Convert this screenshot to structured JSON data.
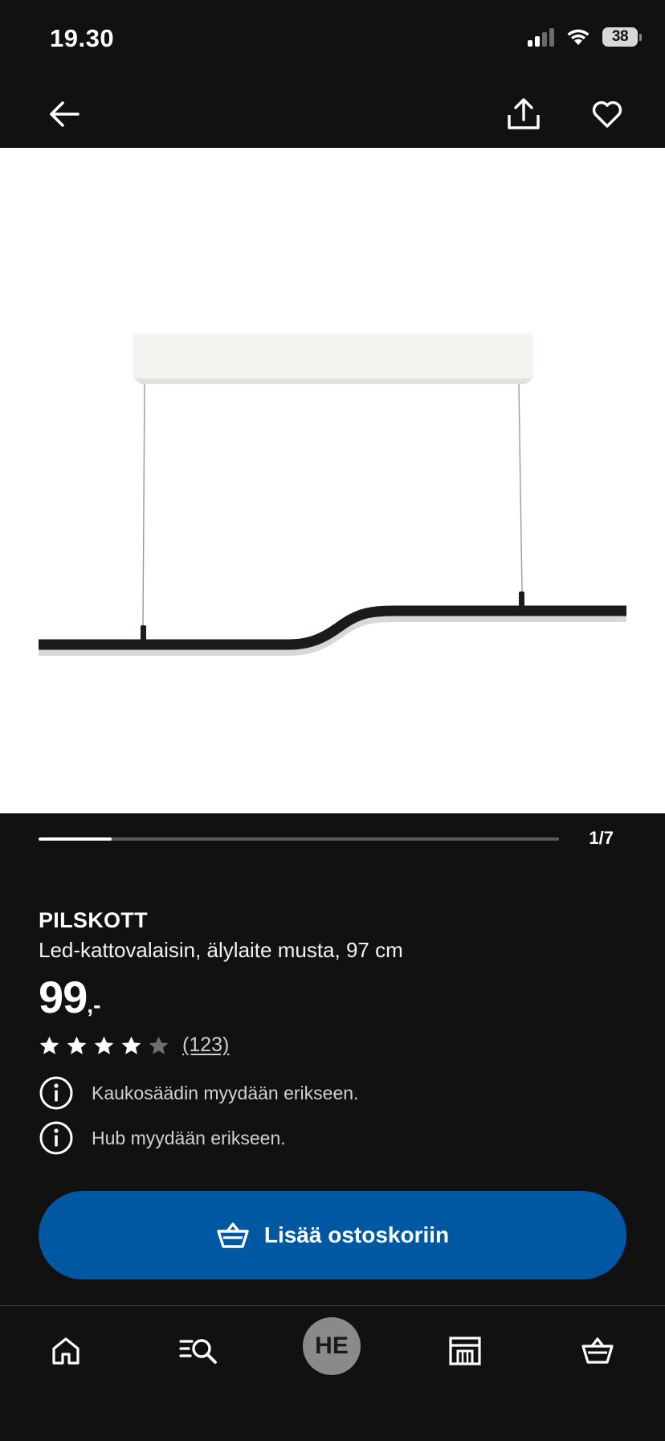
{
  "status_bar": {
    "time": "19.30",
    "battery": "38"
  },
  "nav": {
    "back_icon": "arrow-left-icon",
    "share_icon": "share-icon",
    "favorite_icon": "heart-icon"
  },
  "gallery": {
    "counter": "1/7",
    "progress": 0.14
  },
  "product": {
    "name": "PILSKOTT",
    "description": "Led-kattovalaisin, älylaite musta, 97 cm",
    "price_main": "99",
    "price_suffix": ",-",
    "rating": 4,
    "rating_max": 5,
    "review_count": "(123)",
    "notes": [
      "Kaukosäädin myydään erikseen.",
      "Hub myydään erikseen."
    ]
  },
  "cart_button": {
    "label": "Lisää ostoskoriin",
    "color": "#0058a3"
  },
  "tab_bar": {
    "items": [
      {
        "icon": "home-icon"
      },
      {
        "icon": "search-icon"
      },
      {
        "avatar": "HE"
      },
      {
        "icon": "store-icon"
      },
      {
        "icon": "basket-icon"
      }
    ]
  }
}
